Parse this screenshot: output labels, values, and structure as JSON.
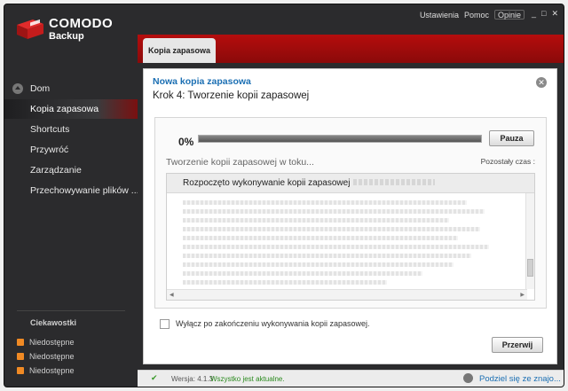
{
  "app": {
    "brand_name": "COMODO",
    "product_name": "Backup",
    "brand_color": "#b50d0d"
  },
  "top_menu": {
    "settings": "Ustawienia",
    "help": "Pomoc",
    "options": "Opinie"
  },
  "window_controls": {
    "minimize": "_",
    "maximize": "□",
    "close": "✕"
  },
  "sidebar": {
    "items": [
      {
        "label": "Dom",
        "icon": "home-icon"
      },
      {
        "label": "Kopia zapasowa",
        "active": true
      },
      {
        "label": "Shortcuts"
      },
      {
        "label": "Przywróć"
      },
      {
        "label": "Zarządzanie"
      },
      {
        "label": "Przechowywanie plików ..."
      }
    ],
    "news_title": "Ciekawostki",
    "news_items": [
      "Niedostępne",
      "Niedostępne",
      "Niedostępne"
    ]
  },
  "main": {
    "tab_label": "Kopia zapasowa",
    "panel_title": "Nowa kopia zapasowa",
    "step_title": "Krok 4: Tworzenie kopii zapasowej",
    "progress_percent_text": "0%",
    "progress_value": 0,
    "pause_label": "Pauza",
    "status_text": "Tworzenie kopii zapasowej w toku...",
    "remaining_label": "Pozostały czas :",
    "log_header": "Rozpoczęto wykonywanie kopii zapasowej",
    "shutdown_checkbox_label": "Wyłącz po zakończeniu wykonywania kopii zapasowej.",
    "shutdown_checked": false,
    "stop_label": "Przerwij"
  },
  "statusbar": {
    "version": "Wersja: 4.1.3",
    "up_to_date": "Wszystko jest aktualne.",
    "share_link": "Podziel się ze znajo..."
  }
}
